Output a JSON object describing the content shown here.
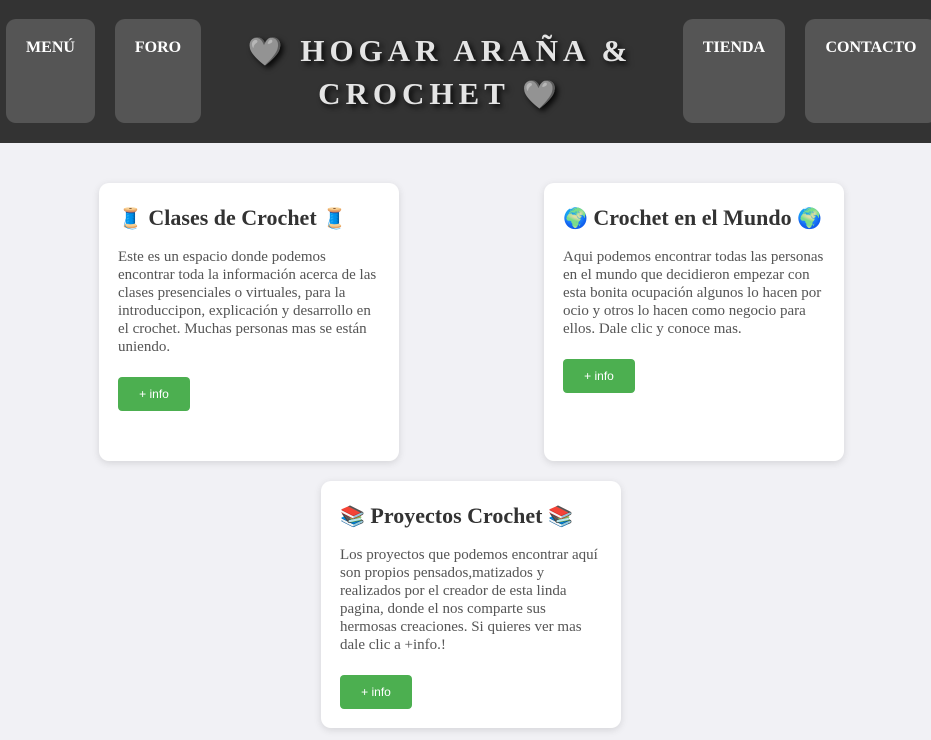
{
  "header": {
    "nav": {
      "menu": "MENÚ",
      "foro": "FORO",
      "tienda": "TIENDA",
      "contacto": "CONTACTO"
    },
    "title_line1": "HOGAR ARAÑA &",
    "title_line2": "CROCHET",
    "heart_icon": "🩶"
  },
  "cards": [
    {
      "icon": "🧵",
      "title": "Clases de Crochet",
      "text": "Este es un espacio donde podemos encontrar toda la información acerca de las clases presenciales o virtuales, para la introduccipon, explicación y desarrollo en el crochet. Muchas personas mas se están uniendo.",
      "button": "+ info"
    },
    {
      "icon": "🌍",
      "title": "Crochet en el Mundo",
      "text": "Aqui podemos encontrar todas las personas en el mundo que decidieron empezar con esta bonita ocupación algunos lo hacen por ocio y otros lo hacen como negocio para ellos. Dale clic y conoce mas.",
      "button": "+ info"
    },
    {
      "icon": "📚",
      "title": "Proyectos Crochet",
      "text": "Los proyectos que podemos encontrar aquí son propios pensados,matizados y realizados por el creador de esta linda pagina, donde el nos comparte sus hermosas creaciones. Si quieres ver mas dale clic a +info.!",
      "button": "+ info"
    }
  ],
  "colors": {
    "header_bg": "#333333",
    "nav_bg": "#555555",
    "page_bg": "#f1f1f5",
    "button_bg": "#4caf50"
  }
}
